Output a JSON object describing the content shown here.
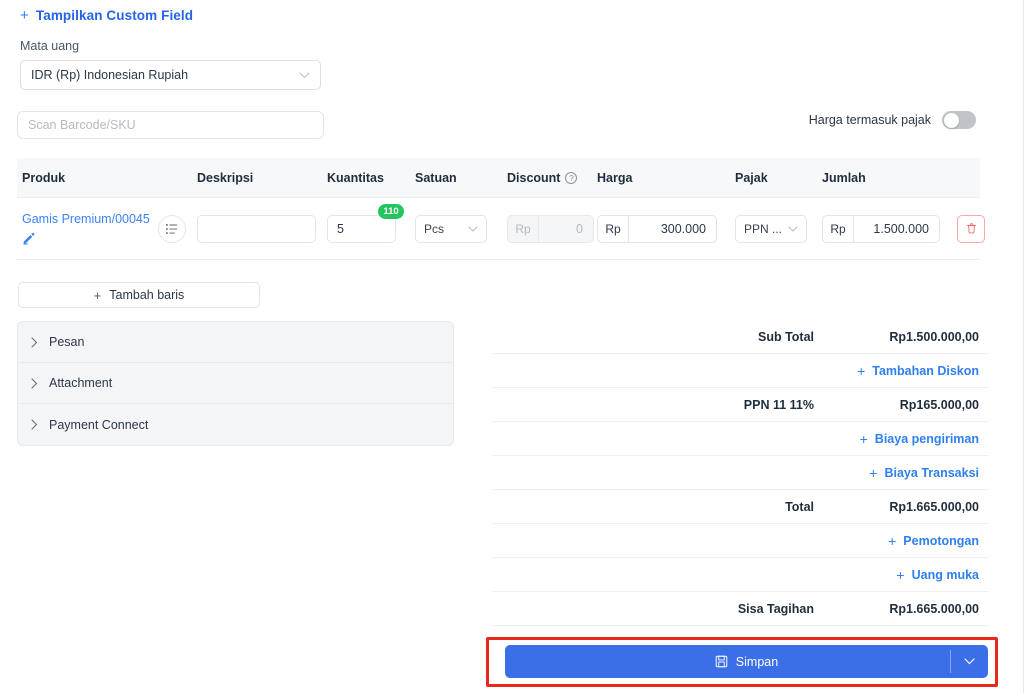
{
  "header": {
    "custom_field_link": "Tampilkan Custom Field",
    "plus": "+"
  },
  "currency": {
    "label": "Mata uang",
    "value": "IDR (Rp) Indonesian Rupiah"
  },
  "barcode": {
    "placeholder": "Scan Barcode/SKU",
    "value": ""
  },
  "tax_toggle": {
    "label": "Harga termasuk pajak",
    "state": "off"
  },
  "table": {
    "columns": [
      "Produk",
      "Deskripsi",
      "Kuantitas",
      "Satuan",
      "Discount",
      "Harga",
      "Pajak",
      "Jumlah"
    ],
    "rows": [
      {
        "product": "Gamis Premium/00045",
        "description": "",
        "quantity": "5",
        "quantity_badge": "110",
        "unit": "Pcs",
        "discount_prefix": "Rp",
        "discount": "0",
        "price_prefix": "Rp",
        "price": "300.000",
        "tax": "PPN ...",
        "amount_prefix": "Rp",
        "amount": "1.500.000"
      }
    ]
  },
  "add_row": {
    "label": "Tambah baris",
    "plus": "+"
  },
  "accordion": {
    "items": [
      {
        "label": "Pesan"
      },
      {
        "label": "Attachment"
      },
      {
        "label": "Payment Connect"
      }
    ]
  },
  "summary": {
    "rows": [
      {
        "type": "value",
        "label": "Sub Total",
        "value": "Rp1.500.000,00"
      },
      {
        "type": "link",
        "label": "Tambahan Diskon"
      },
      {
        "type": "value",
        "label": "PPN 11 11%",
        "value": "Rp165.000,00"
      },
      {
        "type": "link",
        "label": "Biaya pengiriman"
      },
      {
        "type": "link",
        "label": "Biaya Transaksi"
      },
      {
        "type": "value",
        "label": "Total",
        "value": "Rp1.665.000,00"
      },
      {
        "type": "link",
        "label": "Pemotongan"
      },
      {
        "type": "link",
        "label": "Uang muka"
      },
      {
        "type": "value",
        "label": "Sisa Tagihan",
        "value": "Rp1.665.000,00"
      }
    ]
  },
  "save": {
    "label": "Simpan",
    "caret": "⌄"
  },
  "colors": {
    "accent_blue": "#2f7fee",
    "button_blue": "#3b6fe8",
    "badge_green": "#22c55e",
    "delete_red": "#f9a7a7",
    "highlight_red": "#e8271d"
  }
}
